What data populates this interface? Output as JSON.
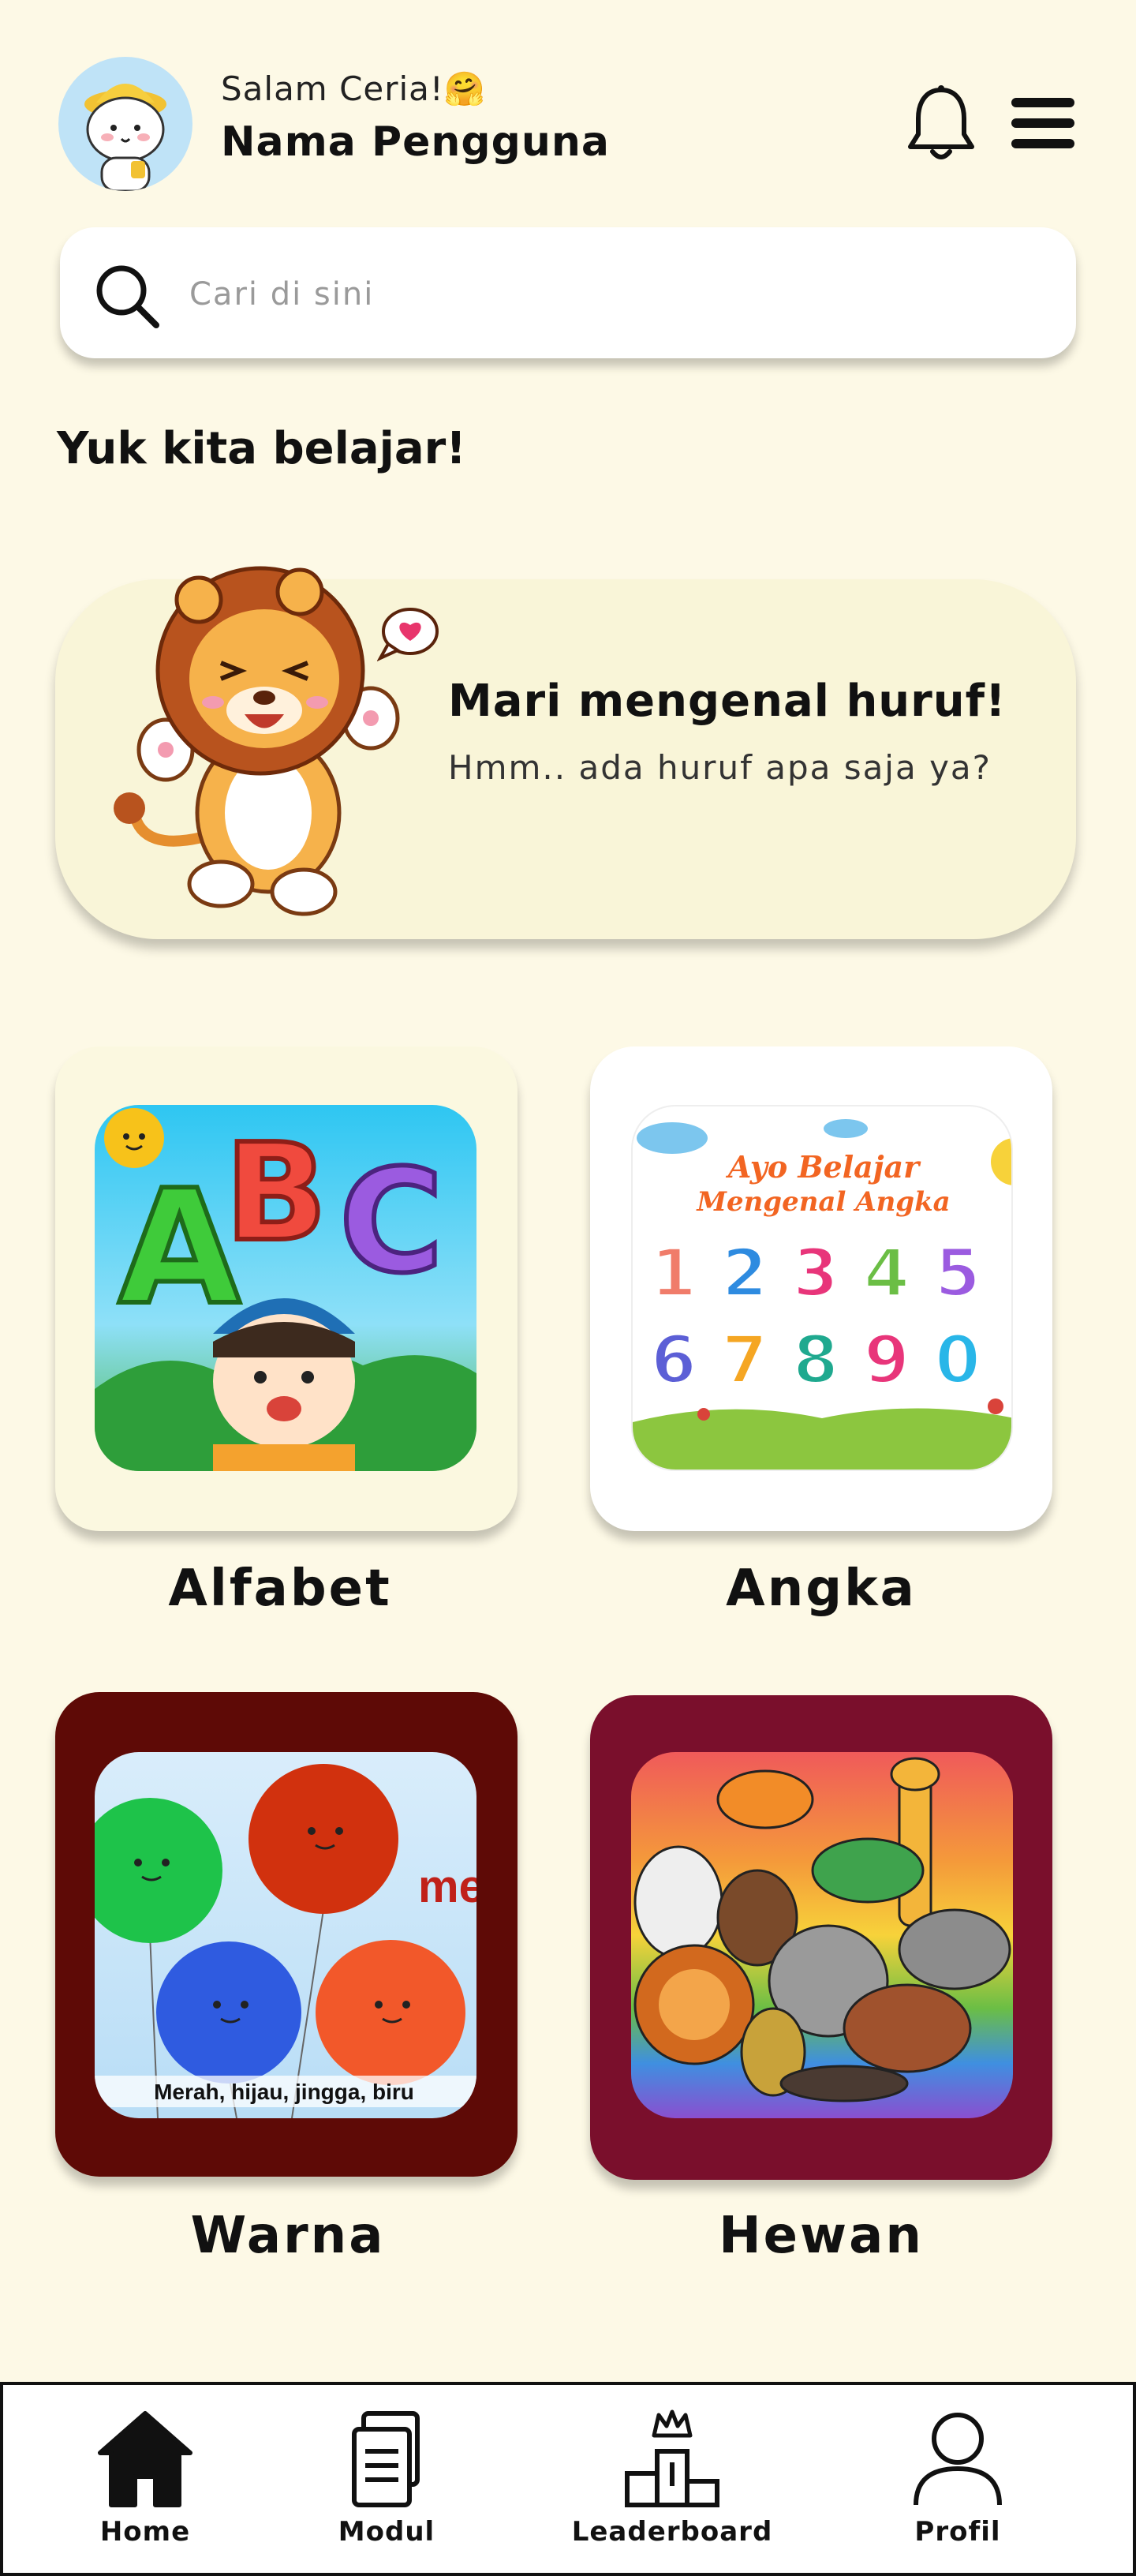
{
  "header": {
    "greeting": "Salam Ceria!🤗",
    "username": "Nama Pengguna"
  },
  "search": {
    "placeholder": "Cari di sini"
  },
  "section_title": "Yuk kita belajar!",
  "promo": {
    "title": "Mari mengenal huruf!",
    "subtitle": "Hmm.. ada huruf apa saja ya?"
  },
  "modules": [
    {
      "label": "Alfabet",
      "card_color": "#FBF8E0"
    },
    {
      "label": "Angka",
      "card_color": "#FFFFFF",
      "banner_line1": "Ayo Belajar",
      "banner_line2": "Mengenal Angka",
      "digits": [
        "1",
        "2",
        "3",
        "4",
        "5",
        "6",
        "7",
        "8",
        "9",
        "0"
      ]
    },
    {
      "label": "Warna",
      "card_color": "#5E0A06",
      "caption": "Merah, hijau, jingga, biru",
      "side_text": "me"
    },
    {
      "label": "Hewan",
      "card_color": "#7A0F2C"
    }
  ],
  "nav": [
    {
      "label": "Home",
      "icon": "home-icon"
    },
    {
      "label": "Modul",
      "icon": "module-icon"
    },
    {
      "label": "Leaderboard",
      "icon": "leaderboard-icon"
    },
    {
      "label": "Profil",
      "icon": "profile-icon"
    }
  ]
}
